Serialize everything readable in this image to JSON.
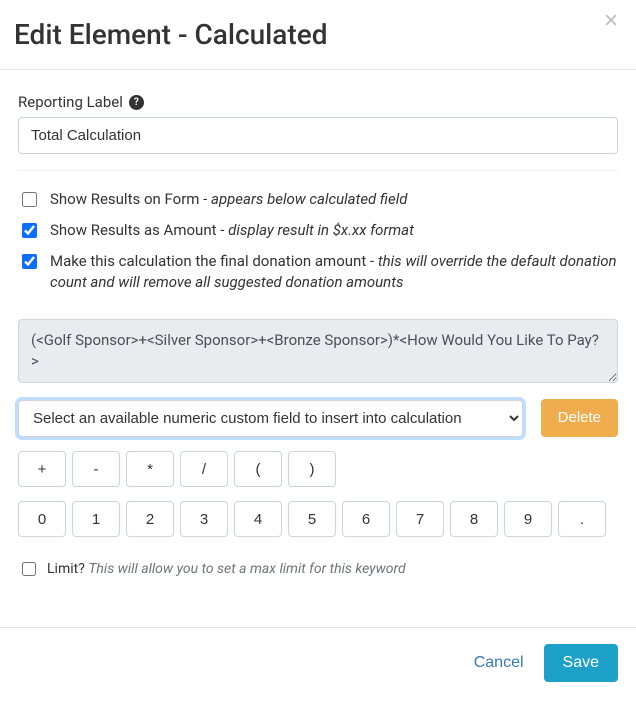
{
  "modal": {
    "title": "Edit Element - Calculated",
    "close_label": "×"
  },
  "reporting": {
    "label": "Reporting Label",
    "value": "Total Calculation"
  },
  "options": {
    "show_results_form": {
      "checked": false,
      "label": "Show Results on Form",
      "desc": "appears below calculated field"
    },
    "show_results_amount": {
      "checked": true,
      "label": "Show Results as Amount",
      "desc": "display result in $x.xx format"
    },
    "final_donation": {
      "checked": true,
      "label": "Make this calculation the final donation amount",
      "desc": "this will override the default donation count and will remove all suggested donation amounts"
    }
  },
  "formula": {
    "value": "(<Golf Sponsor>+<Silver Sponsor>+<Bronze Sponsor>)*<How Would You Like To Pay?>"
  },
  "field_select": {
    "placeholder": "Select an available numeric custom field to insert into calculation"
  },
  "buttons": {
    "delete": "Delete",
    "cancel": "Cancel",
    "save": "Save"
  },
  "operators": [
    "+",
    "-",
    "*",
    "/",
    "(",
    ")"
  ],
  "digits": [
    "0",
    "1",
    "2",
    "3",
    "4",
    "5",
    "6",
    "7",
    "8",
    "9",
    "."
  ],
  "limit": {
    "checked": false,
    "label": "Limit?",
    "desc": "This will allow you to set a max limit for this keyword"
  }
}
